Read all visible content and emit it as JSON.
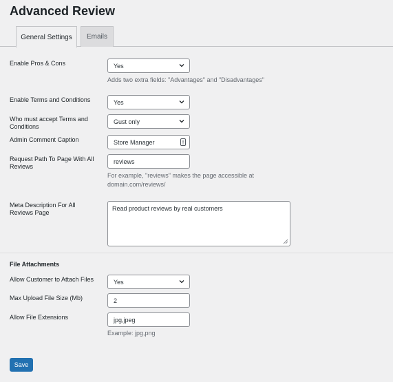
{
  "page": {
    "title": "Advanced Review"
  },
  "tabs": [
    {
      "label": "General Settings",
      "active": true
    },
    {
      "label": "Emails",
      "active": false
    }
  ],
  "fields": {
    "pros_cons": {
      "label": "Enable Pros & Cons",
      "value": "Yes",
      "description": "Adds two extra fields: \"Advantages\" and \"Disadvantages\""
    },
    "terms": {
      "label": "Enable Terms and Conditions",
      "value": "Yes"
    },
    "who_accept": {
      "label": "Who must accept Terms and Conditions",
      "value": "Gust only"
    },
    "admin_caption": {
      "label": "Admin Comment Caption",
      "value": "Store Manager"
    },
    "request_path": {
      "label": "Request Path To Page With All Reviews",
      "value": "reviews",
      "description_1": "For example, \"reviews\" makes the page accessible at",
      "description_2": "domain.com/reviews/"
    },
    "meta_description": {
      "label": "Meta Description For All Reviews Page",
      "value": "Read product reviews by real customers"
    }
  },
  "file_attachments": {
    "section_title": "File Attachments",
    "allow_attach": {
      "label": "Allow Customer to Attach Files",
      "value": "Yes"
    },
    "max_size": {
      "label": "Max Upload File Size (Mb)",
      "value": "2"
    },
    "extensions": {
      "label": "Allow File Extensions",
      "value": "jpg,jpeg",
      "description": "Example: jpg,png"
    }
  },
  "actions": {
    "save_label": "Save"
  },
  "colors": {
    "primary": "#2271b1",
    "background": "#f0f0f1",
    "border": "#8c8f94"
  },
  "icons": {
    "select_arrow": "chevron-down-icon",
    "field_icon": "document-icon",
    "resize": "resize-grip-icon"
  }
}
